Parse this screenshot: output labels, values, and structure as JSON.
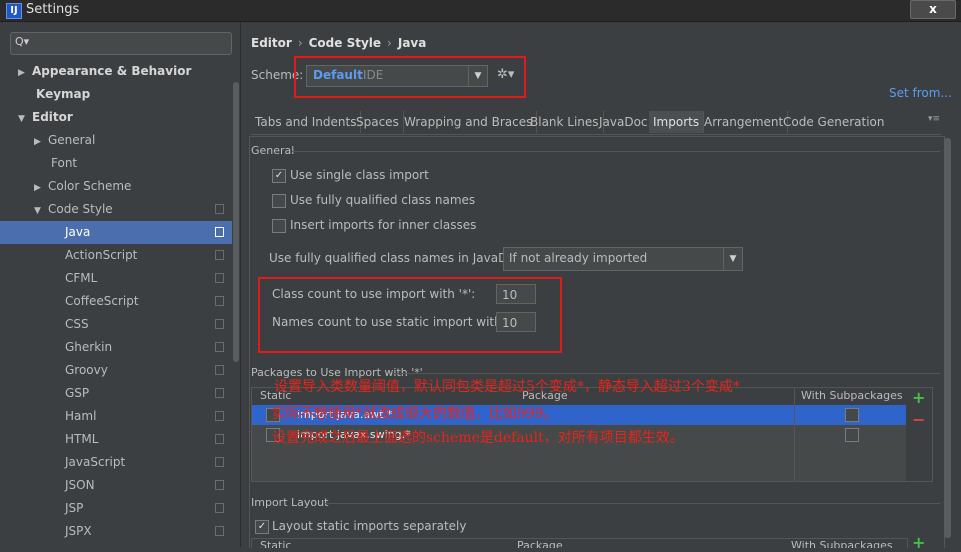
{
  "window": {
    "title": "Settings",
    "close_label": "x",
    "app_icon_glyph": "IJ"
  },
  "sidebar": {
    "search_glyph": "Q▾",
    "items": [
      {
        "label": "Appearance & Behavior",
        "arrow": "▶"
      },
      {
        "label": "Keymap",
        "arrow": ""
      },
      {
        "label": "Editor",
        "arrow": "▼"
      },
      {
        "label": "General",
        "arrow": "▶"
      },
      {
        "label": "Font",
        "arrow": ""
      },
      {
        "label": "Color Scheme",
        "arrow": "▶"
      },
      {
        "label": "Code Style",
        "arrow": "▼"
      },
      {
        "label": "Java",
        "arrow": ""
      },
      {
        "label": "ActionScript",
        "arrow": ""
      },
      {
        "label": "CFML",
        "arrow": ""
      },
      {
        "label": "CoffeeScript",
        "arrow": ""
      },
      {
        "label": "CSS",
        "arrow": ""
      },
      {
        "label": "Gherkin",
        "arrow": ""
      },
      {
        "label": "Groovy",
        "arrow": ""
      },
      {
        "label": "GSP",
        "arrow": ""
      },
      {
        "label": "Haml",
        "arrow": ""
      },
      {
        "label": "HTML",
        "arrow": ""
      },
      {
        "label": "JavaScript",
        "arrow": ""
      },
      {
        "label": "JSON",
        "arrow": ""
      },
      {
        "label": "JSP",
        "arrow": ""
      },
      {
        "label": "JSPX",
        "arrow": ""
      }
    ]
  },
  "breadcrumb": {
    "part1": "Editor",
    "sep": "›",
    "part2": "Code Style",
    "part3": "Java"
  },
  "scheme": {
    "label": "Scheme:",
    "name": "Default",
    "sub": "IDE",
    "arrow": "▼",
    "gear_glyph": "✲▾",
    "set_from": "Set from..."
  },
  "tabs": [
    {
      "label": "Tabs and Indents"
    },
    {
      "label": "Spaces"
    },
    {
      "label": "Wrapping and Braces"
    },
    {
      "label": "Blank Lines"
    },
    {
      "label": "JavaDoc"
    },
    {
      "label": "Imports"
    },
    {
      "label": "Arrangement"
    },
    {
      "label": "Code Generation"
    }
  ],
  "tab_menu_glyph": "▾≡",
  "general": {
    "title": "General",
    "check_glyph": "✓",
    "options": [
      {
        "label": "Use single class import",
        "checked": true
      },
      {
        "label": "Use fully qualified class names",
        "checked": false
      },
      {
        "label": "Insert imports for inner classes",
        "checked": false
      }
    ],
    "javadoc_label": "Use fully qualified class names in JavaDoc:",
    "javadoc_value": "If not already imported",
    "javadoc_arrow": "▼",
    "class_count_label": "Class count to use import with '*':",
    "class_count_value": "10",
    "names_count_label": "Names count to use static import with '*':",
    "names_count_value": "10"
  },
  "packages": {
    "title": "Packages to Use Import with '*'",
    "col_static": "Static",
    "col_package": "Package",
    "col_subpackages": "With Subpackages",
    "rows": [
      {
        "package": "import java.awt.*",
        "selected": true
      },
      {
        "package": "import javax.swing.*",
        "selected": false
      }
    ],
    "add_glyph": "+",
    "remove_glyph": "−"
  },
  "annotations": {
    "line1": "设置导入类数量阈值，默认同包类是超过5个变成*，静态导入超过3个变成*",
    "line2": "实际不想使用*就改成很大的数值，比如999。",
    "line3": "设置完成之后最上面选的scheme是default，对所有项目都生效。"
  },
  "import_layout": {
    "title": "Import Layout",
    "option_label": "Layout static imports separately",
    "col_static": "Static",
    "col_package": "Package",
    "col_subpackages": "With Subpackages",
    "add_glyph": "+"
  },
  "colors": {
    "accent": "#4b6eaf",
    "highlight_red": "#e01b1b",
    "link": "#589df6"
  }
}
